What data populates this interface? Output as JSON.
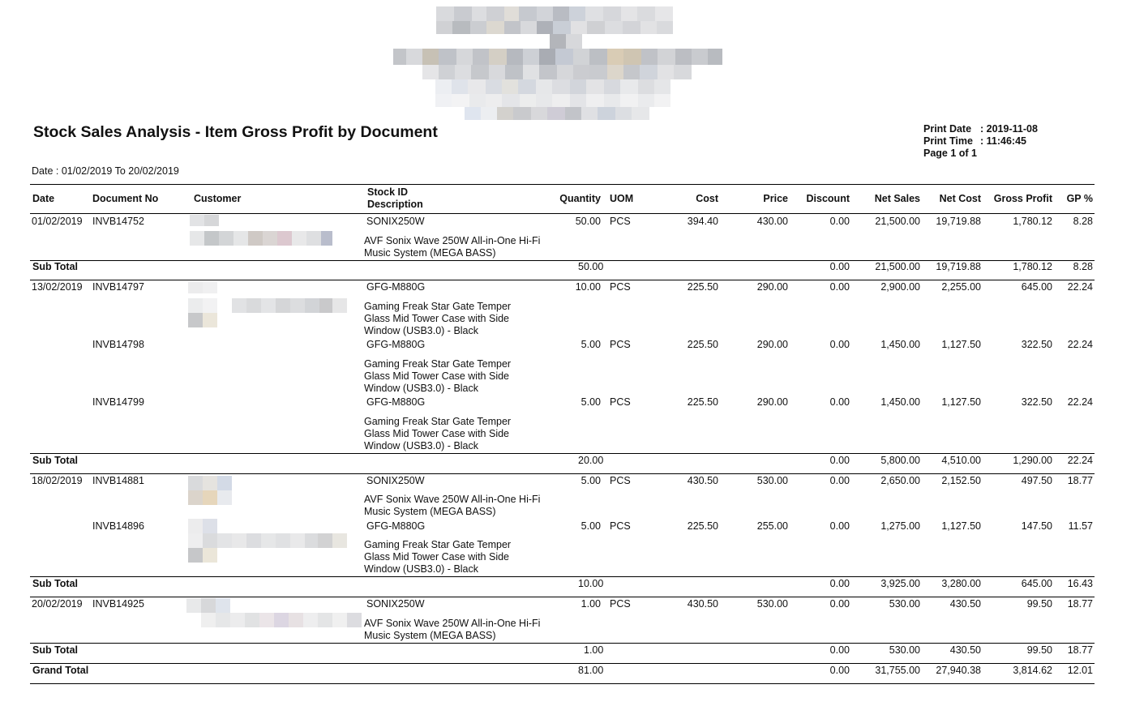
{
  "report": {
    "title": "Stock Sales Analysis - Item Gross Profit by Document",
    "print_date_label": "Print Date",
    "print_date": "2019-11-08",
    "print_time_label": "Print Time",
    "print_time": "11:46:45",
    "page_label": "Page 1 of 1",
    "date_range": "Date : 01/02/2019 To 20/02/2019"
  },
  "columns": {
    "date": "Date",
    "document_no": "Document No",
    "customer": "Customer",
    "stock_id": "Stock ID",
    "description": "Description",
    "quantity": "Quantity",
    "uom": "UOM",
    "cost": "Cost",
    "price": "Price",
    "discount": "Discount",
    "net_sales": "Net Sales",
    "net_cost": "Net Cost",
    "gross_profit": "Gross Profit",
    "gp_pct": "GP %"
  },
  "rows": [
    {
      "date": "01/02/2019",
      "doc": "INVB14752",
      "stock_id": "SONIX250W",
      "qty": "50.00",
      "uom": "PCS",
      "cost": "394.40",
      "price": "430.00",
      "discount": "0.00",
      "net_sales": "21,500.00",
      "net_cost": "19,719.88",
      "gross_profit": "1,780.12",
      "gp": "8.28",
      "description": "AVF Sonix Wave 250W All-in-One Hi-Fi Music System (MEGA BASS)"
    },
    {
      "date": "13/02/2019",
      "doc": "INVB14797",
      "stock_id": "GFG-M880G",
      "qty": "10.00",
      "uom": "PCS",
      "cost": "225.50",
      "price": "290.00",
      "discount": "0.00",
      "net_sales": "2,900.00",
      "net_cost": "2,255.00",
      "gross_profit": "645.00",
      "gp": "22.24",
      "description": "Gaming Freak Star Gate Temper Glass Mid Tower Case with Side Window (USB3.0) - Black"
    },
    {
      "date": "",
      "doc": "INVB14798",
      "stock_id": "GFG-M880G",
      "qty": "5.00",
      "uom": "PCS",
      "cost": "225.50",
      "price": "290.00",
      "discount": "0.00",
      "net_sales": "1,450.00",
      "net_cost": "1,127.50",
      "gross_profit": "322.50",
      "gp": "22.24",
      "description": "Gaming Freak Star Gate Temper Glass Mid Tower Case with Side Window (USB3.0) - Black"
    },
    {
      "date": "",
      "doc": "INVB14799",
      "stock_id": "GFG-M880G",
      "qty": "5.00",
      "uom": "PCS",
      "cost": "225.50",
      "price": "290.00",
      "discount": "0.00",
      "net_sales": "1,450.00",
      "net_cost": "1,127.50",
      "gross_profit": "322.50",
      "gp": "22.24",
      "description": "Gaming Freak Star Gate Temper Glass Mid Tower Case with Side Window (USB3.0) - Black"
    },
    {
      "date": "18/02/2019",
      "doc": "INVB14881",
      "stock_id": "SONIX250W",
      "qty": "5.00",
      "uom": "PCS",
      "cost": "430.50",
      "price": "530.00",
      "discount": "0.00",
      "net_sales": "2,650.00",
      "net_cost": "2,152.50",
      "gross_profit": "497.50",
      "gp": "18.77",
      "description": "AVF Sonix Wave 250W All-in-One Hi-Fi Music System (MEGA BASS)"
    },
    {
      "date": "",
      "doc": "INVB14896",
      "stock_id": "GFG-M880G",
      "qty": "5.00",
      "uom": "PCS",
      "cost": "225.50",
      "price": "255.00",
      "discount": "0.00",
      "net_sales": "1,275.00",
      "net_cost": "1,127.50",
      "gross_profit": "147.50",
      "gp": "11.57",
      "description": "Gaming Freak Star Gate Temper Glass Mid Tower Case with Side Window (USB3.0) - Black"
    },
    {
      "date": "20/02/2019",
      "doc": "INVB14925",
      "stock_id": "SONIX250W",
      "qty": "1.00",
      "uom": "PCS",
      "cost": "430.50",
      "price": "530.00",
      "discount": "0.00",
      "net_sales": "530.00",
      "net_cost": "430.50",
      "gross_profit": "99.50",
      "gp": "18.77",
      "description": "AVF Sonix Wave 250W All-in-One Hi-Fi Music System (MEGA BASS)"
    }
  ],
  "subtotals": [
    {
      "label": "Sub Total",
      "qty": "50.00",
      "discount": "0.00",
      "net_sales": "21,500.00",
      "net_cost": "19,719.88",
      "gross_profit": "1,780.12",
      "gp": "8.28"
    },
    {
      "label": "Sub Total",
      "qty": "20.00",
      "discount": "0.00",
      "net_sales": "5,800.00",
      "net_cost": "4,510.00",
      "gross_profit": "1,290.00",
      "gp": "22.24"
    },
    {
      "label": "Sub Total",
      "qty": "10.00",
      "discount": "0.00",
      "net_sales": "3,925.00",
      "net_cost": "3,280.00",
      "gross_profit": "645.00",
      "gp": "16.43"
    },
    {
      "label": "Sub Total",
      "qty": "1.00",
      "discount": "0.00",
      "net_sales": "530.00",
      "net_cost": "430.50",
      "gross_profit": "99.50",
      "gp": "18.77"
    }
  ],
  "grand_total": {
    "label": "Grand Total",
    "qty": "81.00",
    "discount": "0.00",
    "net_sales": "31,755.00",
    "net_cost": "27,940.38",
    "gross_profit": "3,814.62",
    "gp": "12.01"
  }
}
